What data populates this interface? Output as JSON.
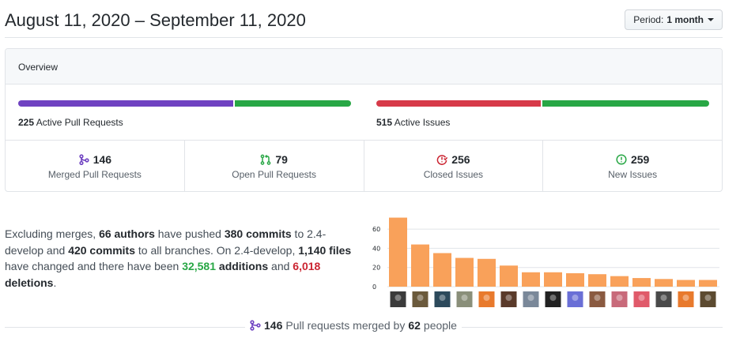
{
  "header": {
    "date_range": "August 11, 2020 – September 11, 2020",
    "period_prefix": "Period:",
    "period_value": "1 month"
  },
  "overview": {
    "title": "Overview",
    "pull_requests": {
      "active_count": "225",
      "active_label": "Active Pull Requests",
      "merged_fraction": 0.649,
      "open_fraction": 0.351
    },
    "issues": {
      "active_count": "515",
      "active_label": "Active Issues",
      "closed_fraction": 0.497,
      "new_fraction": 0.503
    },
    "stats": [
      {
        "value": "146",
        "label": "Merged Pull Requests",
        "icon": "git-merge-icon",
        "color": "#6f42c1"
      },
      {
        "value": "79",
        "label": "Open Pull Requests",
        "icon": "git-pull-request-icon",
        "color": "#28a745"
      },
      {
        "value": "256",
        "label": "Closed Issues",
        "icon": "issue-closed-icon",
        "color": "#cb2431"
      },
      {
        "value": "259",
        "label": "New Issues",
        "icon": "issue-opened-icon",
        "color": "#28a745"
      }
    ]
  },
  "summary": {
    "t1": "Excluding merges, ",
    "authors": "66 authors",
    "t2": " have pushed ",
    "commits_branch": "380 commits",
    "t3": " to 2.4-develop and ",
    "commits_all": "420 commits",
    "t4": " to all branches. On 2.4-develop, ",
    "files": "1,140 files",
    "t5": " have changed and there have been ",
    "additions": "32,581",
    "t6": " additions",
    "t7": " and ",
    "deletions": "6,018",
    "t8": " deletions",
    "t9": "."
  },
  "chart_data": {
    "type": "bar",
    "ylim": [
      0,
      70
    ],
    "yticks": [
      0,
      20,
      40,
      60
    ],
    "values": [
      72,
      44,
      35,
      30,
      29,
      22,
      15,
      15,
      14,
      13,
      11,
      9,
      8,
      7,
      7
    ],
    "bar_color": "#f9a15a",
    "avatar_colors": [
      "#3b3b3b",
      "#6b5a3c",
      "#2d4a5c",
      "#8a8f7a",
      "#e87a2d",
      "#5a3a2a",
      "#7a8899",
      "#222222",
      "#6a6fd6",
      "#8a5a40",
      "#c86a7a",
      "#e05a6a",
      "#4a4a4a",
      "#e87a2d",
      "#5c4a30"
    ]
  },
  "footer": {
    "count": "146",
    "text1": " Pull requests merged by ",
    "people": "62",
    "text2": " people"
  }
}
